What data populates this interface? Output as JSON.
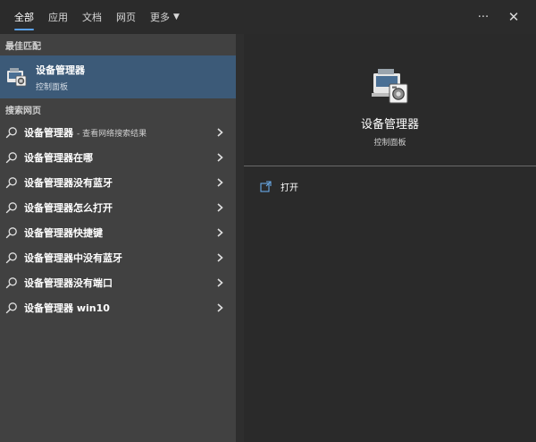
{
  "tabs": [
    {
      "label": "全部",
      "active": true
    },
    {
      "label": "应用",
      "active": false
    },
    {
      "label": "文档",
      "active": false
    },
    {
      "label": "网页",
      "active": false
    },
    {
      "label": "更多",
      "active": false,
      "dropdown": true
    }
  ],
  "top_actions": {
    "more_icon": "ellipsis-icon",
    "close_icon": "close-icon",
    "more_glyph": "···",
    "close_glyph": "✕"
  },
  "best_match": {
    "section_label": "最佳匹配",
    "title": "设备管理器",
    "subtitle": "控制面板",
    "icon": "device-manager-icon"
  },
  "web_search": {
    "section_label": "搜索网页",
    "items": [
      {
        "text": "设备管理器",
        "suffix": "- 查看网络搜索结果"
      },
      {
        "text": "设备管理器在哪",
        "suffix": ""
      },
      {
        "text": "设备管理器没有蓝牙",
        "suffix": ""
      },
      {
        "text": "设备管理器怎么打开",
        "suffix": ""
      },
      {
        "text": "设备管理器快捷键",
        "suffix": ""
      },
      {
        "text": "设备管理器中没有蓝牙",
        "suffix": ""
      },
      {
        "text": "设备管理器没有端口",
        "suffix": ""
      },
      {
        "text": "设备管理器 win10",
        "suffix": ""
      }
    ]
  },
  "detail": {
    "title": "设备管理器",
    "subtitle": "控制面板",
    "actions": [
      {
        "label": "打开",
        "icon": "open-icon"
      }
    ]
  },
  "colors": {
    "accent": "#5aa0e6",
    "selected_bg": "#3c5a78",
    "left_bg": "#414141",
    "right_bg": "#2a2a2a"
  }
}
